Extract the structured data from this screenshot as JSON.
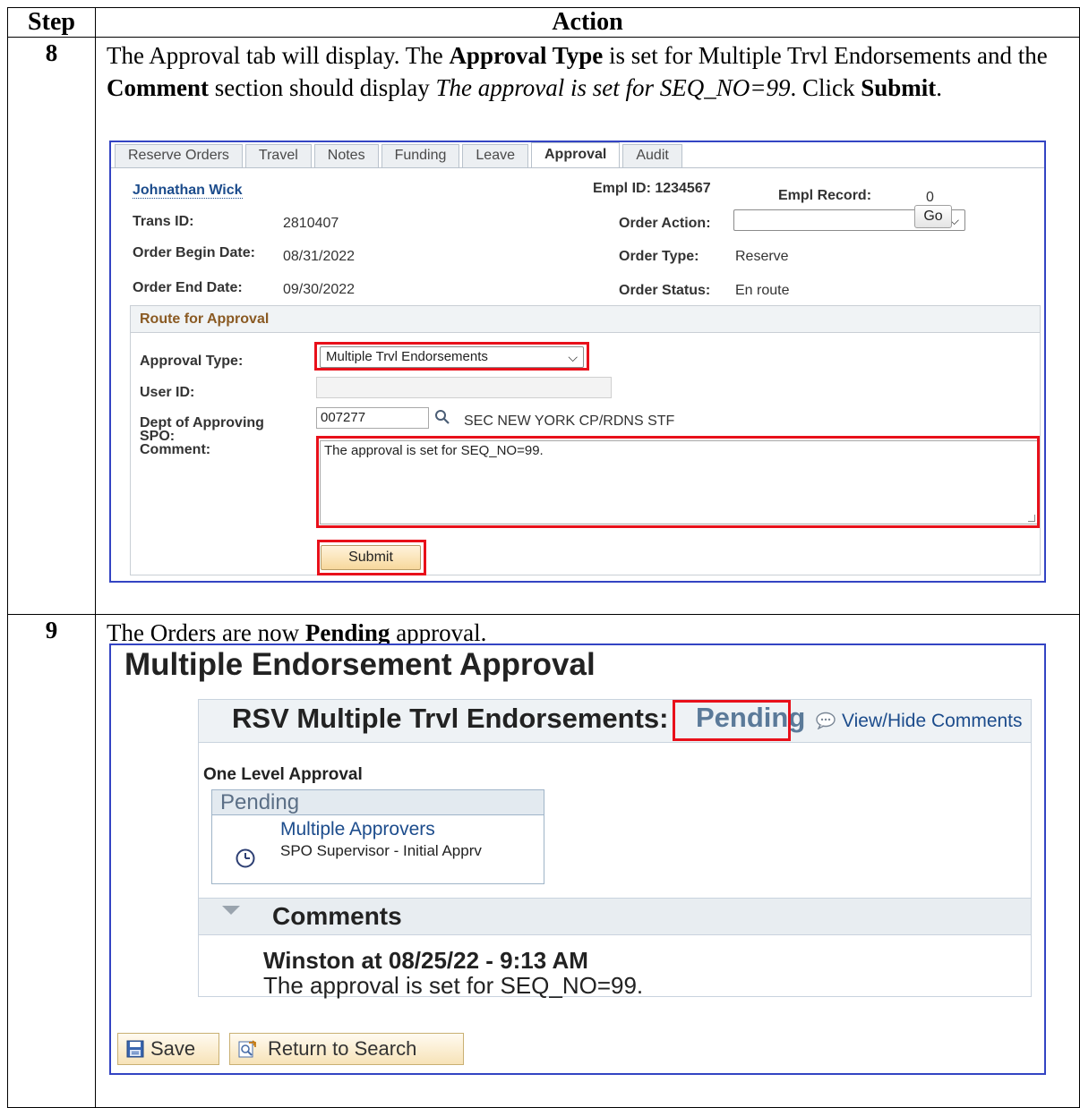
{
  "table": {
    "header_step": "Step",
    "header_action": "Action"
  },
  "step8": {
    "number": "8",
    "text_part1": "The Approval tab will display. The ",
    "bold1": "Approval Type",
    "text_part2": " is set for Multiple Trvl Endorsements and the ",
    "bold2": "Comment",
    "text_part3": " section should display ",
    "italic": "The approval is set for SEQ_NO=99",
    "text_part4": ".  Click ",
    "bold3": "Submit",
    "text_part5": "."
  },
  "screen1": {
    "tabs": [
      "Reserve Orders",
      "Travel",
      "Notes",
      "Funding",
      "Leave",
      "Approval",
      "Audit"
    ],
    "active_tab": "Approval",
    "employee_name": "Johnathan Wick",
    "empl_id_label": "Empl ID: 1234567",
    "empl_record_label": "Empl Record:",
    "empl_record_value": "0",
    "trans_id_label": "Trans ID:",
    "trans_id_value": "2810407",
    "order_action_label": "Order Action:",
    "order_action_value": "",
    "go_label": "Go",
    "begin_label": "Order Begin Date:",
    "begin_value": "08/31/2022",
    "order_type_label": "Order Type:",
    "order_type_value": "Reserve",
    "end_label": "Order End Date:",
    "end_value": "09/30/2022",
    "order_status_label": "Order Status:",
    "order_status_value": "En route",
    "route_title": "Route for Approval",
    "approval_type_label": "Approval Type:",
    "approval_type_value": "Multiple Trvl Endorsements",
    "user_id_label": "User ID:",
    "user_id_value": "",
    "dept_label_1": "Dept of Approving",
    "dept_label_2": "SPO:",
    "dept_value": "007277",
    "dept_desc": "SEC NEW YORK CP/RDNS STF",
    "comment_label": "Comment:",
    "comment_value": "The approval is set for SEQ_NO=99.",
    "submit_label": "Submit",
    "highlight_color": "#e8101a",
    "frame_color": "#3344c3"
  },
  "step9": {
    "number": "9",
    "text_part1": "The Orders are now ",
    "bold1": "Pending",
    "text_part2": " approval."
  },
  "screen2": {
    "title": "Multiple Endorsement Approval",
    "header_title": "RSV Multiple Trvl Endorsements:",
    "status": "Pending",
    "view_hide": "View/Hide Comments",
    "level": "One Level Approval",
    "stage_status": "Pending",
    "approvers_link": "Multiple Approvers",
    "approvers_role": "SPO Supervisor - Initial Apprv",
    "comments_title": "Comments",
    "comment_author": "Winston at 08/25/22 - 9:13 AM",
    "comment_text": "The approval is set for SEQ_NO=99.",
    "save_label": "Save",
    "return_label": "Return to Search",
    "icons": {
      "save": "save-icon",
      "return": "return-to-search-icon",
      "clock": "clock-icon",
      "comment": "comment-bubble-icon",
      "expand": "collapse-triangle-icon",
      "lookup": "search-icon",
      "dropdown": "chevron-down-icon"
    }
  }
}
